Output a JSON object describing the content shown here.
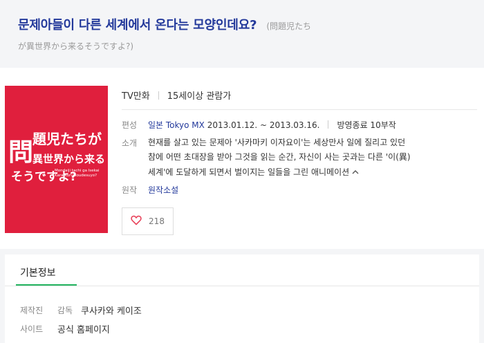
{
  "header": {
    "title": "문제아들이 다른 세계에서 온다는 모양인데요?",
    "original_title_1": "(問題児たち",
    "original_title_2": "が異世界から来るそうですよ?)"
  },
  "poster": {
    "logo_text_1": "問",
    "logo_text_2": "題児たちが",
    "logo_text_3": "異世界から来る",
    "logo_text_4": "そうですよ?",
    "romaji_1": "Mondaiji tachi ga Isekai",
    "romaji_2": "Kara Kuru soudesuyo?",
    "bg_color": "#e01f3d"
  },
  "meta": {
    "type": "TV만화",
    "rating": "15세이상 관람가",
    "broadcast_label": "편성",
    "broadcast_channel": "일본 Tokyo MX",
    "broadcast_dates": "2013.01.12. ~ 2013.03.16.",
    "broadcast_status": "방영종료 10부작",
    "intro_label": "소개",
    "intro_line_1": "현재를 살고 있는 문제아 '사카마키 이자요이'는 세상만사 일에 질리고 있던",
    "intro_line_2": "참에 어떤 초대장을 받아 그것을 읽는 순간, 자신이 사는 곳과는 다른 '이(異)",
    "intro_line_3": "세계'에 도달하게 되면서 벌이지는 일들을 그린 애니메이션",
    "original_label": "원작",
    "original_value": "원작소설"
  },
  "like": {
    "count": "218",
    "accent_color": "#e8455c"
  },
  "info": {
    "tab_label": "기본정보",
    "production_label": "제작진",
    "director_label": "감독",
    "director_value": "쿠사카와 케이조",
    "site_label": "사이트",
    "site_value": "공식 홈페이지"
  }
}
